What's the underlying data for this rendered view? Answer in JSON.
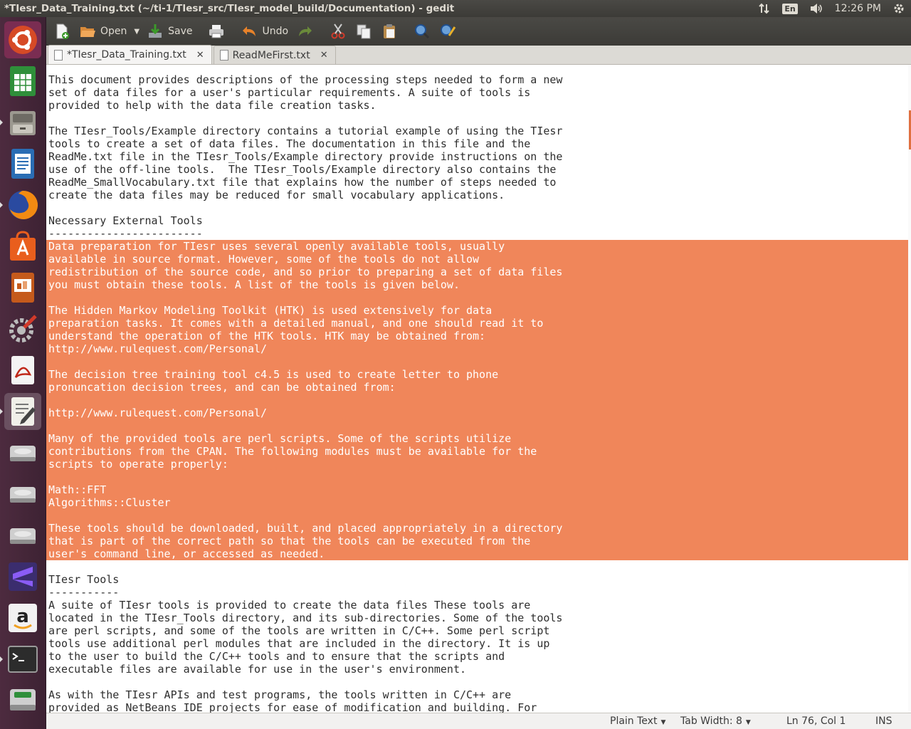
{
  "window_title": "*TIesr_Data_Training.txt (~/ti-1/TIesr_src/TIesr_model_build/Documentation) - gedit",
  "indicators": {
    "keyboard": "En",
    "clock": "12:26 PM"
  },
  "launcher": {
    "items": [
      "ubuntu-dash",
      "libreoffice-calc",
      "files",
      "libreoffice-writer",
      "firefox",
      "software-center",
      "libreoffice-impress",
      "system-settings",
      "document-viewer",
      "text-editor",
      "drive-1",
      "drive-2",
      "drive-3",
      "sublime-text",
      "amazon",
      "terminal",
      "drive-removable"
    ]
  },
  "toolbar": {
    "open_label": "Open",
    "save_label": "Save",
    "undo_label": "Undo"
  },
  "tabs": [
    {
      "label": "*TIesr_Data_Training.txt",
      "active": true
    },
    {
      "label": "ReadMeFirst.txt",
      "active": false
    }
  ],
  "document": {
    "lines": [
      "This document provides descriptions of the processing steps needed to form a new",
      "set of data files for a user's particular requirements. A suite of tools is",
      "provided to help with the data file creation tasks.",
      "",
      "The TIesr_Tools/Example directory contains a tutorial example of using the TIesr",
      "tools to create a set of data files. The documentation in this file and the",
      "ReadMe.txt file in the TIesr_Tools/Example directory provide instructions on the",
      "use of the off-line tools.  The TIesr_Tools/Example directory also contains the",
      "ReadMe_SmallVocabulary.txt file that explains how the number of steps needed to",
      "create the data files may be reduced for small vocabulary applications.",
      "",
      "Necessary External Tools",
      "------------------------",
      "Data preparation for TIesr uses several openly available tools, usually",
      "available in source format. However, some of the tools do not allow",
      "redistribution of the source code, and so prior to preparing a set of data files",
      "you must obtain these tools. A list of the tools is given below.",
      "",
      "The Hidden Markov Modeling Toolkit (HTK) is used extensively for data",
      "preparation tasks. It comes with a detailed manual, and one should read it to",
      "understand the operation of the HTK tools. HTK may be obtained from:",
      "http://www.rulequest.com/Personal/",
      "",
      "The decision tree training tool c4.5 is used to create letter to phone",
      "pronuncation decision trees, and can be obtained from:",
      "",
      "http://www.rulequest.com/Personal/",
      "",
      "Many of the provided tools are perl scripts. Some of the scripts utilize",
      "contributions from the CPAN. The following modules must be available for the",
      "scripts to operate properly:",
      "",
      "Math::FFT",
      "Algorithms::Cluster",
      "",
      "These tools should be downloaded, built, and placed appropriately in a directory",
      "that is part of the correct path so that the tools can be executed from the",
      "user's command line, or accessed as needed.",
      "",
      "TIesr Tools",
      "-----------",
      "A suite of TIesr tools is provided to create the data files These tools are",
      "located in the TIesr_Tools directory, and its sub-directories. Some of the tools",
      "are perl scripts, and some of the tools are written in C/C++. Some perl script",
      "tools use additional perl modules that are included in the directory. It is up",
      "to the user to build the C/C++ tools and to ensure that the scripts and",
      "executable files are available for use in the user's environment.",
      "",
      "As with the TIesr APIs and test programs, the tools written in C/C++ are",
      "provided as NetBeans IDE projects for ease of modification and building. For"
    ],
    "selection_first_line": 13,
    "selection_last_line": 37
  },
  "statusbar": {
    "language": "Plain Text",
    "tab_width": "Tab Width: 8",
    "position": "Ln 76, Col 1",
    "mode": "INS"
  },
  "colors": {
    "selection": "#f0865a",
    "launcher": "#4d2b3f",
    "panel": "#3c3b37"
  }
}
